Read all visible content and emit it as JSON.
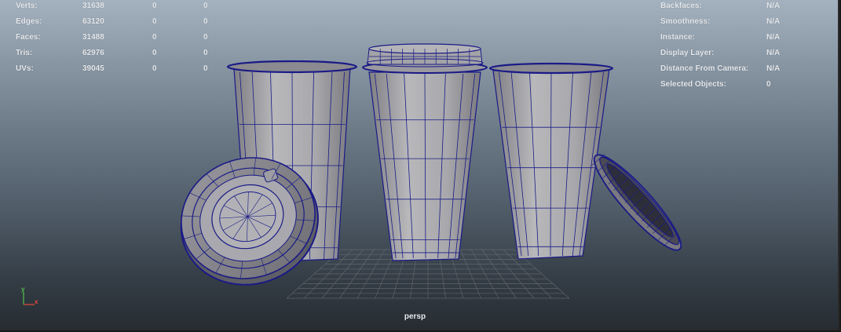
{
  "stats": {
    "rows": [
      {
        "label": "Verts:",
        "v1": "31638",
        "v2": "0",
        "v3": "0"
      },
      {
        "label": "Edges:",
        "v1": "63120",
        "v2": "0",
        "v3": "0"
      },
      {
        "label": "Faces:",
        "v1": "31488",
        "v2": "0",
        "v3": "0"
      },
      {
        "label": "Tris:",
        "v1": "62976",
        "v2": "0",
        "v3": "0"
      },
      {
        "label": "UVs:",
        "v1": "39045",
        "v2": "0",
        "v3": "0"
      }
    ]
  },
  "info": {
    "rows": [
      {
        "label": "Backfaces:",
        "value": "N/A"
      },
      {
        "label": "Smoothness:",
        "value": "N/A"
      },
      {
        "label": "Instance:",
        "value": "N/A"
      },
      {
        "label": "Display Layer:",
        "value": "N/A"
      },
      {
        "label": "Distance From Camera:",
        "value": "N/A"
      },
      {
        "label": "Selected Objects:",
        "value": "0"
      }
    ]
  },
  "camera": {
    "name": "persp"
  },
  "axis": {
    "y_label": "y",
    "x_label": "x"
  },
  "colors": {
    "wire": "#1a1a86",
    "surface": "#b2b2b4",
    "surface_dark": "#7c7c80",
    "grid": "#6b6e72",
    "axis_x": "#e24a3a",
    "axis_y": "#57c04f"
  },
  "objects": [
    {
      "name": "cup-left"
    },
    {
      "name": "cup-center"
    },
    {
      "name": "cup-right"
    },
    {
      "name": "lid-left"
    },
    {
      "name": "lid-right"
    },
    {
      "name": "lid-top"
    }
  ]
}
